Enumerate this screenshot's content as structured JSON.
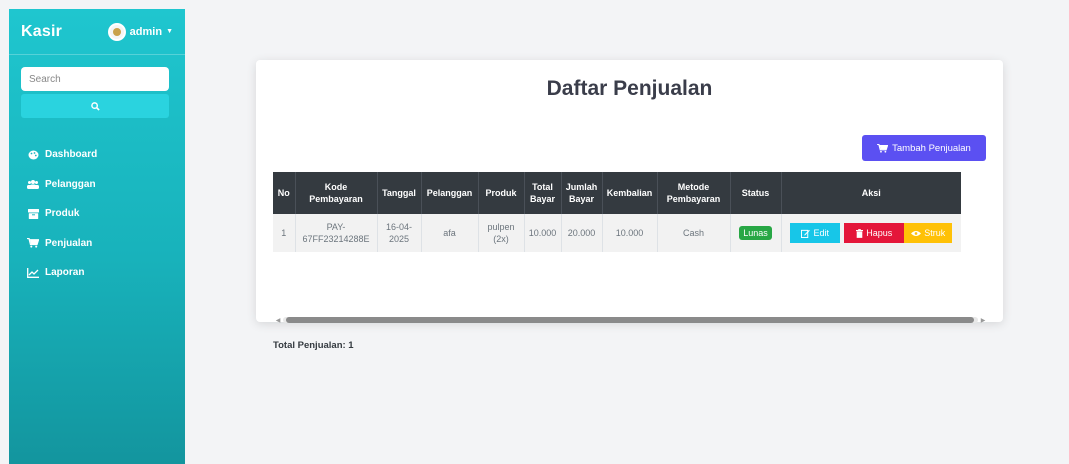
{
  "sidebar": {
    "brand": "Kasir",
    "user": "admin",
    "search_placeholder": "Search",
    "items": [
      {
        "label": "Dashboard",
        "icon": "palette-icon"
      },
      {
        "label": "Pelanggan",
        "icon": "users-icon"
      },
      {
        "label": "Produk",
        "icon": "box-icon"
      },
      {
        "label": "Penjualan",
        "icon": "cart-icon"
      },
      {
        "label": "Laporan",
        "icon": "chart-line-icon"
      }
    ]
  },
  "main": {
    "title": "Daftar Penjualan",
    "add_button": "Tambah Penjualan",
    "table": {
      "headers": [
        "No",
        "Kode Pembayaran",
        "Tanggal",
        "Pelanggan",
        "Produk",
        "Total Bayar",
        "Jumlah Bayar",
        "Kembalian",
        "Metode Pembayaran",
        "Status",
        "Aksi"
      ],
      "rows": [
        {
          "no": "1",
          "kode": "PAY-67FF23214288E",
          "tanggal": "16-04-2025",
          "pelanggan": "afa",
          "produk": "pulpen (2x)",
          "total": "10.000",
          "jumlah": "20.000",
          "kembalian": "10.000",
          "metode": "Cash",
          "status": "Lunas",
          "actions": {
            "edit": "Edit",
            "hapus": "Hapus",
            "struk": "Struk"
          }
        }
      ]
    },
    "total_label": "Total Penjualan: 1"
  },
  "colors": {
    "sidebar": "#1fc6cf",
    "primary": "#5b50f2",
    "success": "#28a745",
    "info": "#17c6e8",
    "danger": "#e4163a",
    "warning": "#ffc107",
    "table_header": "#343a40"
  }
}
